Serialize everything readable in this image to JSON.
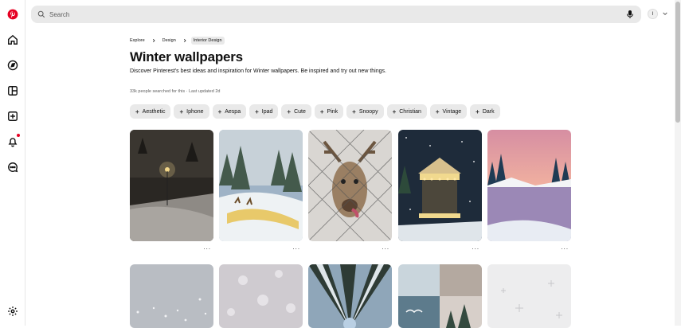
{
  "search": {
    "placeholder": "Search"
  },
  "account": {
    "initial": "I"
  },
  "breadcrumb": [
    "Explore",
    "Design",
    "Interior Design"
  ],
  "page": {
    "title": "Winter wallpapers",
    "description": "Discover Pinterest's best ideas and inspiration for Winter wallpapers. Be inspired and try out new things.",
    "meta": "33k people searched for this · Last updated 2d"
  },
  "chips": [
    "Aesthetic",
    "Iphone",
    "Aespa",
    "Ipad",
    "Cute",
    "Pink",
    "Snoopy",
    "Christian",
    "Vintage",
    "Dark"
  ],
  "pins_row1": [
    {
      "subject": "snowy night street lamp"
    },
    {
      "subject": "winter river with deer painting"
    },
    {
      "subject": "reindeer behind fence"
    },
    {
      "subject": "lit carousel in snow"
    },
    {
      "subject": "pink sunset frozen lake"
    }
  ],
  "pins_row2": [
    {
      "subject": "grey snow texture"
    },
    {
      "subject": "soft snowflake pattern"
    },
    {
      "subject": "looking up at snowy trees"
    },
    {
      "subject": "winter collage hello"
    },
    {
      "subject": "white sparkle pattern"
    }
  ],
  "colors": {
    "brand": "#e60023",
    "chip_bg": "#e9e9e9",
    "search_bg": "#e9e9e9"
  }
}
